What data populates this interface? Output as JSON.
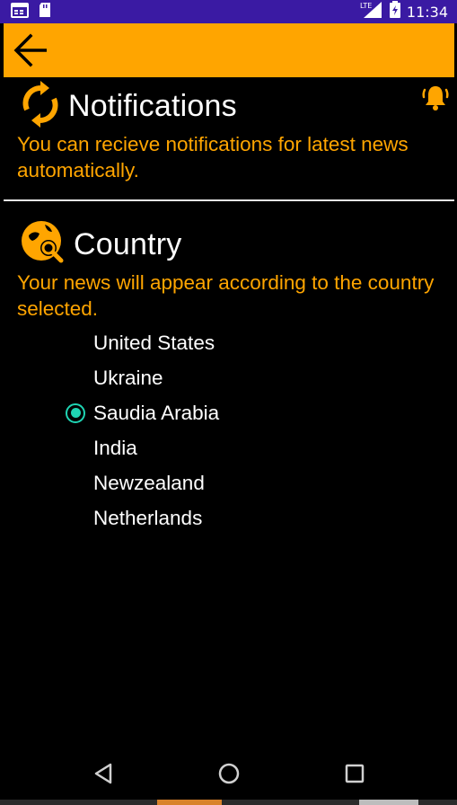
{
  "status_bar": {
    "time": "11:34",
    "network_label": "LTE",
    "icons": [
      "calendar-icon",
      "sd-card-icon",
      "signal-icon",
      "battery-icon"
    ]
  },
  "app_bar": {
    "back_icon": "arrow-back-icon",
    "background_color": "#ffa500"
  },
  "notifications": {
    "title": "Notifications",
    "description": "You can recieve notifications for latest news automatically.",
    "icon": "sync-icon",
    "bell_icon": "bell-icon"
  },
  "country": {
    "title": "Country",
    "description": "Your news will appear according to the country selected.",
    "icon": "globe-search-icon",
    "options": [
      {
        "label": "United States",
        "selected": false
      },
      {
        "label": "Ukraine",
        "selected": false
      },
      {
        "label": "Saudia Arabia",
        "selected": true
      },
      {
        "label": "India",
        "selected": false
      },
      {
        "label": "Newzealand",
        "selected": false
      },
      {
        "label": "Netherlands",
        "selected": false
      }
    ],
    "selected_color": "#1fd4b3"
  },
  "nav_bar": {
    "back": "nav-back-icon",
    "home": "nav-home-icon",
    "recents": "nav-recents-icon"
  },
  "colors": {
    "accent": "#ffa500",
    "status_bar": "#3a1aa3",
    "background": "#000000"
  }
}
